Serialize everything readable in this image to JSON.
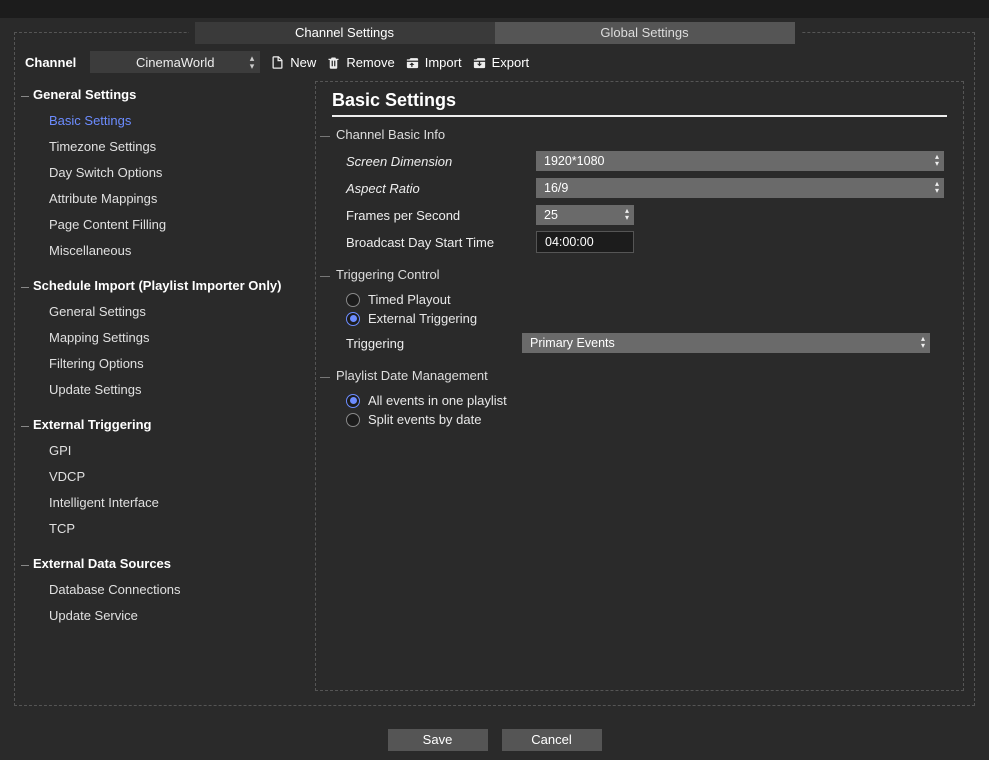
{
  "tabs": {
    "channel": "Channel Settings",
    "global": "Global Settings"
  },
  "toolbar": {
    "channel_label": "Channel",
    "channel_value": "CinemaWorld",
    "new": "New",
    "remove": "Remove",
    "import": "Import",
    "export": "Export"
  },
  "sidebar": {
    "general": {
      "title": "General Settings",
      "items": [
        "Basic Settings",
        "Timezone Settings",
        "Day Switch Options",
        "Attribute Mappings",
        "Page Content Filling",
        "Miscellaneous"
      ]
    },
    "schedule": {
      "title": "Schedule Import (Playlist Importer Only)",
      "items": [
        "General Settings",
        "Mapping Settings",
        "Filtering Options",
        "Update Settings"
      ]
    },
    "ext_trig": {
      "title": "External Triggering",
      "items": [
        "GPI",
        "VDCP",
        "Intelligent Interface",
        "TCP"
      ]
    },
    "ext_data": {
      "title": "External Data Sources",
      "items": [
        "Database Connections",
        "Update Service"
      ]
    }
  },
  "page": {
    "title": "Basic Settings",
    "basic_info": {
      "title": "Channel Basic Info",
      "screen_dim_label": "Screen Dimension",
      "screen_dim_value": "1920*1080",
      "aspect_label": "Aspect Ratio",
      "aspect_value": "16/9",
      "fps_label": "Frames per Second",
      "fps_value": "25",
      "day_start_label": "Broadcast Day Start Time",
      "day_start_value": "04:00:00"
    },
    "trig": {
      "title": "Triggering Control",
      "opt_timed": "Timed Playout",
      "opt_ext": "External Triggering",
      "triggering_label": "Triggering",
      "triggering_value": "Primary Events"
    },
    "playlist": {
      "title": "Playlist Date Management",
      "opt_all": "All events in one playlist",
      "opt_split": "Split events by date"
    }
  },
  "footer": {
    "save": "Save",
    "cancel": "Cancel"
  }
}
